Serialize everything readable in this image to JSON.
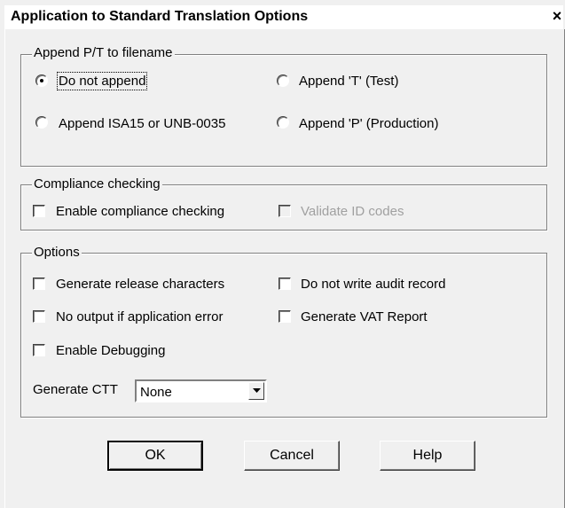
{
  "window": {
    "title": "Application to Standard Translation Options",
    "close_glyph": "×"
  },
  "append_group": {
    "legend": "Append P/T to filename",
    "options": [
      {
        "label": "Do not append",
        "selected": true
      },
      {
        "label": "Append 'T' (Test)",
        "selected": false
      },
      {
        "label": "Append ISA15 or UNB-0035",
        "selected": false
      },
      {
        "label": "Append 'P' (Production)",
        "selected": false
      }
    ]
  },
  "compliance_group": {
    "legend": "Compliance checking",
    "enable_compliance": {
      "label": "Enable compliance checking",
      "checked": false
    },
    "validate_id_codes": {
      "label": "Validate ID codes",
      "checked": false,
      "disabled": true
    }
  },
  "options_group": {
    "legend": "Options",
    "generate_release_chars": {
      "label": "Generate release characters",
      "checked": false
    },
    "no_audit_record": {
      "label": "Do not write audit record",
      "checked": false
    },
    "no_output_on_error": {
      "label": "No output if application error",
      "checked": false
    },
    "generate_vat_report": {
      "label": "Generate VAT Report",
      "checked": false
    },
    "enable_debugging": {
      "label": "Enable Debugging",
      "checked": false
    },
    "generate_ctt": {
      "label": "Generate CTT",
      "value": "None"
    }
  },
  "buttons": {
    "ok": "OK",
    "cancel": "Cancel",
    "help": "Help"
  },
  "colors": {
    "face": "#f0f0f0",
    "shadow": "#808080",
    "disabled_text": "#a0a0a0"
  }
}
